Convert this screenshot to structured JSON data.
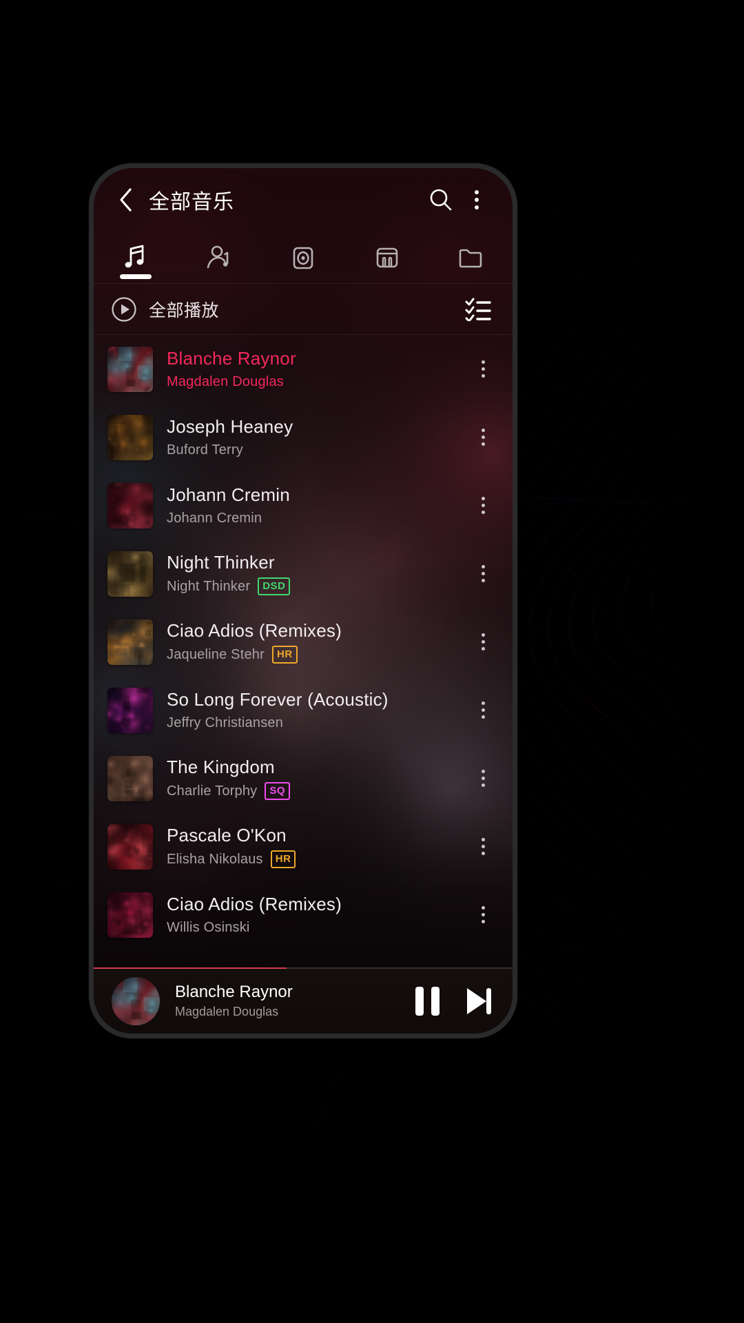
{
  "appbar": {
    "back_icon": "chevron-left-icon",
    "title": "全部音乐",
    "search_icon": "search-icon",
    "overflow_icon": "more-vertical-icon"
  },
  "tabs": [
    {
      "id": "songs",
      "icon": "music-note-icon",
      "active": true
    },
    {
      "id": "artists",
      "icon": "artist-icon",
      "active": false
    },
    {
      "id": "albums",
      "icon": "album-disc-icon",
      "active": false
    },
    {
      "id": "genres",
      "icon": "piano-icon",
      "active": false
    },
    {
      "id": "folders",
      "icon": "folder-icon",
      "active": false
    }
  ],
  "playall": {
    "icon": "play-circle-icon",
    "label": "全部播放",
    "multiselect_icon": "checklist-icon"
  },
  "songs": [
    {
      "title": "Blanche Raynor",
      "artist": "Magdalen Douglas",
      "badge": "",
      "playing": true
    },
    {
      "title": "Joseph Heaney",
      "artist": "Buford Terry",
      "badge": "",
      "playing": false
    },
    {
      "title": "Johann Cremin",
      "artist": "Johann Cremin",
      "badge": "",
      "playing": false
    },
    {
      "title": "Night Thinker",
      "artist": "Night Thinker",
      "badge": "DSD",
      "playing": false
    },
    {
      "title": "Ciao Adios (Remixes)",
      "artist": "Jaqueline Stehr",
      "badge": "HR",
      "playing": false
    },
    {
      "title": "So Long Forever (Acoustic)",
      "artist": "Jeffry Christiansen",
      "badge": "",
      "playing": false
    },
    {
      "title": "The Kingdom",
      "artist": "Charlie Torphy",
      "badge": "SQ",
      "playing": false
    },
    {
      "title": "Pascale O'Kon",
      "artist": "Elisha Nikolaus",
      "badge": "HR",
      "playing": false
    },
    {
      "title": "Ciao Adios (Remixes)",
      "artist": "Willis Osinski",
      "badge": "",
      "playing": false
    }
  ],
  "miniplayer": {
    "title": "Blanche Raynor",
    "artist": "Magdalen Douglas",
    "pause_icon": "pause-icon",
    "next_icon": "skip-next-icon",
    "progress_percent": 46
  },
  "row_menu_icon": "more-vertical-icon",
  "colors": {
    "accent_pink": "#f3285c",
    "badge_dsd": "#3fd96b",
    "badge_hr": "#f0a828",
    "badge_sq": "#ee4df0",
    "text_primary": "#f2eef0",
    "text_secondary": "#a9a2a5",
    "progress": "#d63a4e"
  }
}
